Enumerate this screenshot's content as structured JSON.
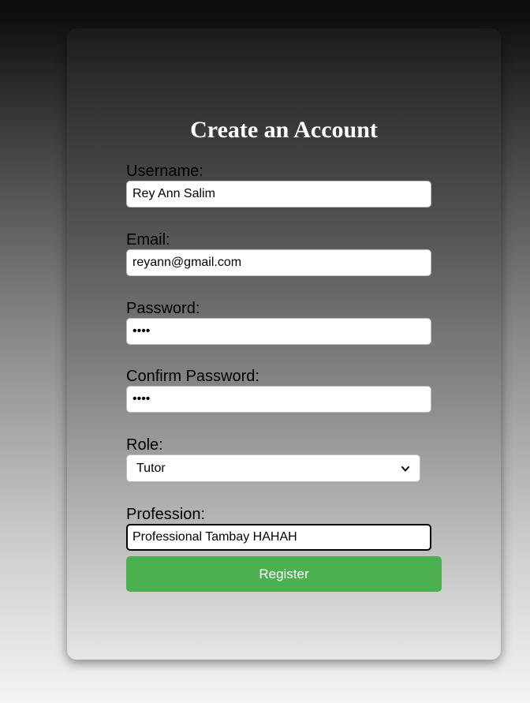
{
  "form": {
    "title": "Create an Account",
    "username": {
      "label": "Username:",
      "value": "Rey Ann Salim"
    },
    "email": {
      "label": "Email:",
      "value": "reyann@gmail.com"
    },
    "password": {
      "label": "Password:",
      "value": "1234"
    },
    "confirm_password": {
      "label": "Confirm Password:",
      "value": "1234"
    },
    "role": {
      "label": "Role:",
      "value": "Tutor",
      "icon": "chevron-down-icon"
    },
    "profession": {
      "label": "Profession:",
      "value": "Professional Tambay HAHAH"
    },
    "register_label": "Register"
  },
  "colors": {
    "button": "#4caf50",
    "button_text": "#ffffff",
    "title": "#ffffff"
  }
}
